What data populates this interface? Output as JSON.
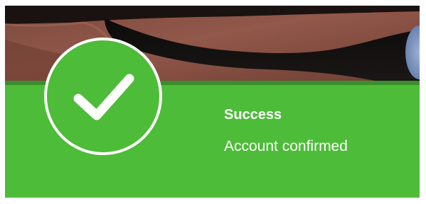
{
  "notification": {
    "title": "Success",
    "message": "Account confirmed",
    "status_icon": "checkmark-icon",
    "accent_color": "#4dbc38",
    "accent_dark": "#3a8f2c",
    "text_color": "#ffffff"
  }
}
